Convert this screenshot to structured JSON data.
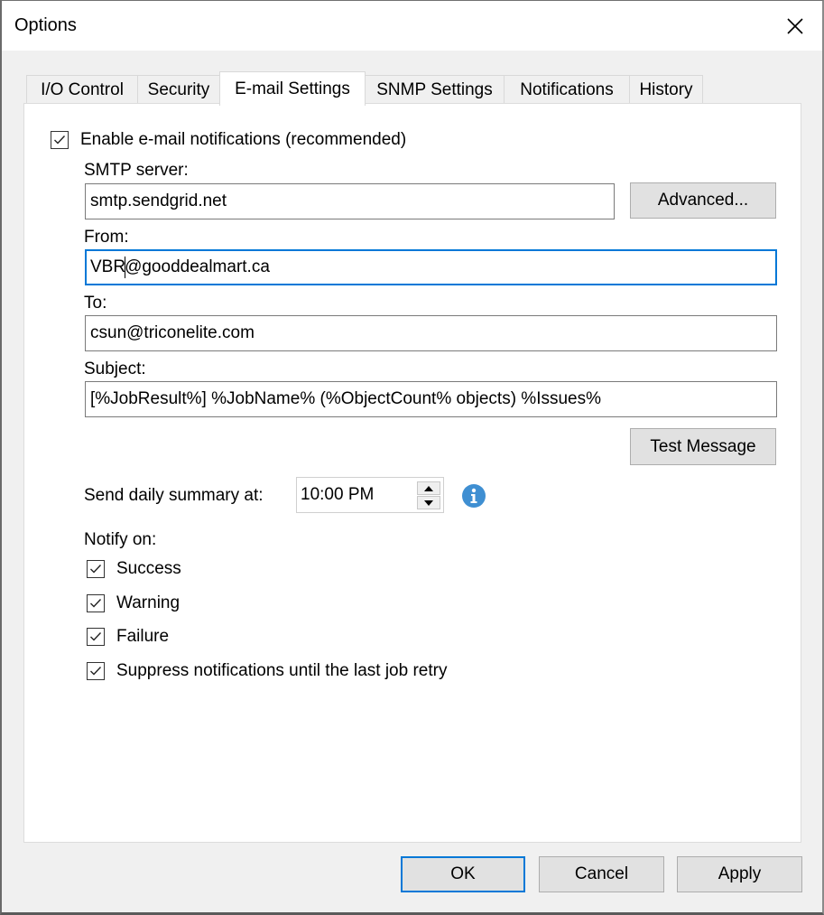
{
  "window": {
    "title": "Options",
    "close_icon": "close-icon"
  },
  "tabs": [
    {
      "label": "I/O Control",
      "active": false
    },
    {
      "label": "Security",
      "active": false
    },
    {
      "label": "E-mail Settings",
      "active": true
    },
    {
      "label": "SNMP Settings",
      "active": false
    },
    {
      "label": "Notifications",
      "active": false
    },
    {
      "label": "History",
      "active": false
    }
  ],
  "email": {
    "enable_label": "Enable e-mail notifications (recommended)",
    "enable_checked": true,
    "smtp_label": "SMTP server:",
    "smtp_value": "smtp.sendgrid.net",
    "advanced_label": "Advanced...",
    "from_label": "From:",
    "from_value_before_caret": "VBR",
    "from_value_after_caret": "@gooddealmart.ca",
    "to_label": "To:",
    "to_value": "csun@triconelite.com",
    "subject_label": "Subject:",
    "subject_value": "[%JobResult%] %JobName% (%ObjectCount% objects) %Issues%",
    "test_label": "Test Message",
    "summary_label": "Send daily summary at:",
    "summary_time": "10:00 PM",
    "info_icon": "info-icon",
    "notify_label": "Notify on:",
    "notify_options": [
      {
        "label": "Success",
        "checked": true
      },
      {
        "label": "Warning",
        "checked": true
      },
      {
        "label": "Failure",
        "checked": true
      },
      {
        "label": "Suppress notifications until the last job retry",
        "checked": true
      }
    ]
  },
  "footer": {
    "ok_label": "OK",
    "cancel_label": "Cancel",
    "apply_label": "Apply"
  },
  "colors": {
    "accent": "#0078d7",
    "info": "#3f8fd2"
  }
}
